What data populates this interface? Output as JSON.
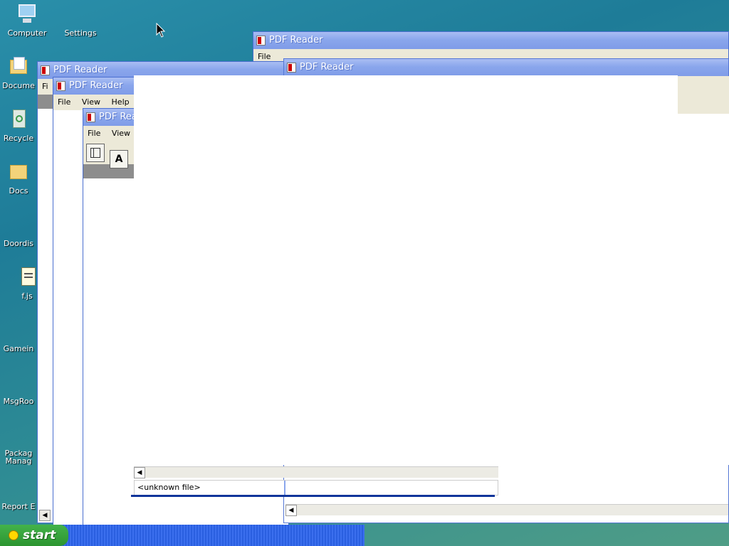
{
  "desktop_icons": [
    {
      "name": "computer",
      "label": "Computer",
      "icon": "computer-icon"
    },
    {
      "name": "settings",
      "label": "Settings",
      "icon": "settings-icon"
    },
    {
      "name": "documents",
      "label": "Docume",
      "icon": "documents-icon"
    },
    {
      "name": "recycle",
      "label": "Recycle",
      "icon": "recycle-bin-icon"
    },
    {
      "name": "docs",
      "label": "Docs",
      "icon": "folder-icon"
    },
    {
      "name": "doordis",
      "label": "Doordis",
      "icon": "app-icon"
    },
    {
      "name": "fjs",
      "label": "f.js",
      "icon": "script-file-icon"
    },
    {
      "name": "gamein",
      "label": "Gamein",
      "icon": "app-icon"
    },
    {
      "name": "msgroo",
      "label": "MsgRoo",
      "icon": "app-icon"
    },
    {
      "name": "package",
      "label": "Packag Manag",
      "icon": "app-icon"
    },
    {
      "name": "report",
      "label": "Report E",
      "icon": "app-icon"
    }
  ],
  "windows": {
    "title": "PDF Reader",
    "title_short": "PDF Rea",
    "menu": {
      "file": "File",
      "view": "View",
      "help": "Help",
      "file_short": "Fi"
    }
  },
  "status": {
    "file": "<unknown file>"
  },
  "taskbar": {
    "start_label": "start"
  },
  "colors": {
    "accent": "#7f9ce8",
    "taskbar": "#2a5fe0",
    "start": "#2c9530"
  }
}
